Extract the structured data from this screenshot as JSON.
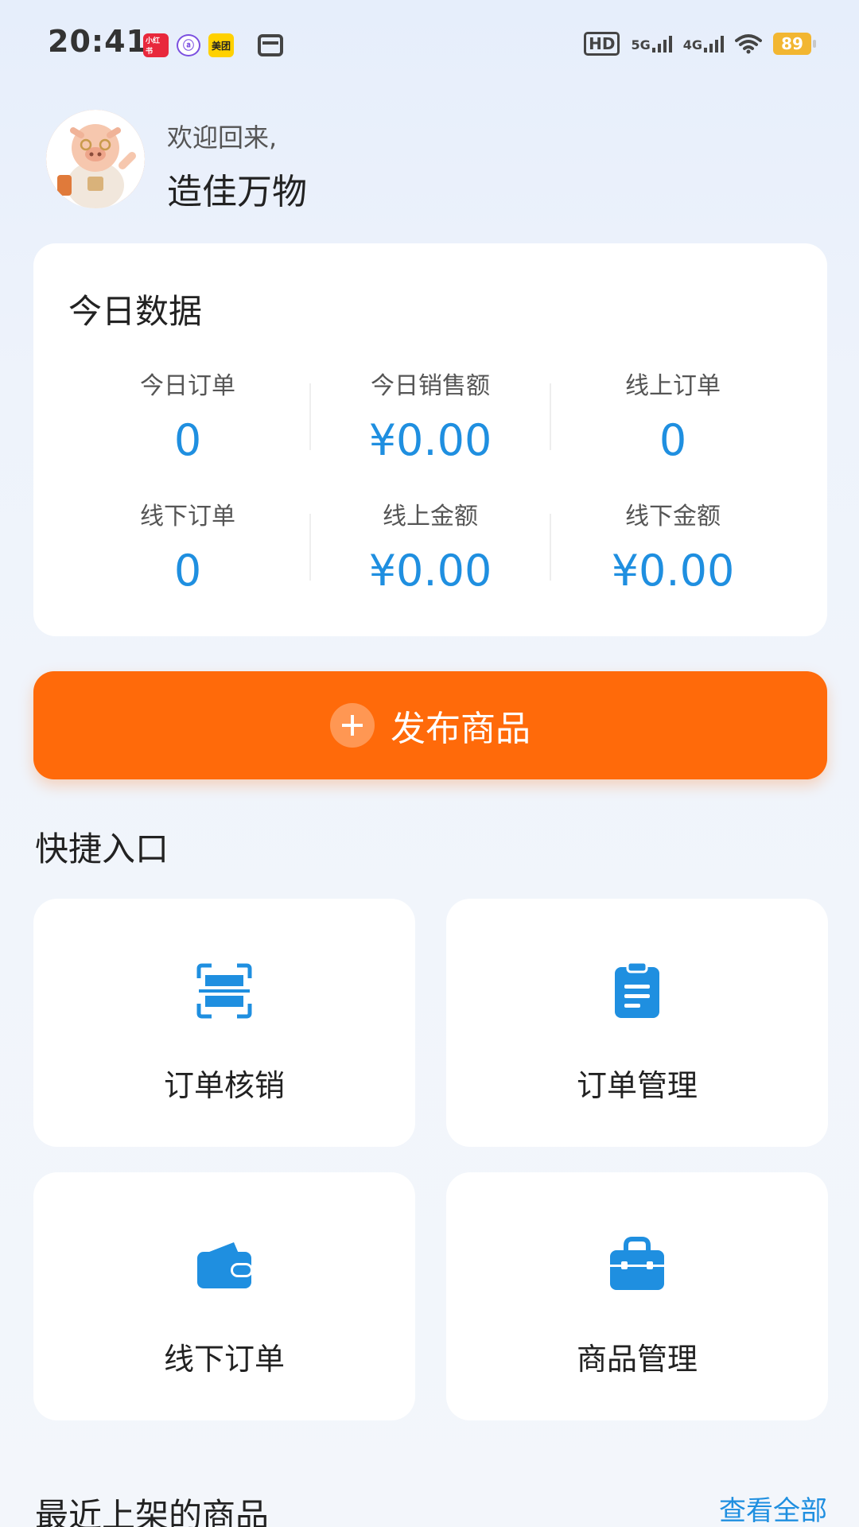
{
  "status_bar": {
    "time": "20:41",
    "app_icons": [
      "小红书",
      "ⓐ",
      "美团"
    ],
    "hd": "HD",
    "net1": "5G",
    "net2": "4G",
    "battery": "89"
  },
  "header": {
    "welcome": "欢迎回来,",
    "shop_name": "造佳万物"
  },
  "today": {
    "title": "今日数据",
    "stats": [
      {
        "label": "今日订单",
        "value": "0"
      },
      {
        "label": "今日销售额",
        "value": "¥0.00"
      },
      {
        "label": "线上订单",
        "value": "0"
      },
      {
        "label": "线下订单",
        "value": "0"
      },
      {
        "label": "线上金额",
        "value": "¥0.00"
      },
      {
        "label": "线下金额",
        "value": "¥0.00"
      }
    ]
  },
  "publish": {
    "label": "发布商品"
  },
  "quick": {
    "title": "快捷入口",
    "items": [
      {
        "label": "订单核销",
        "icon": "scan-icon"
      },
      {
        "label": "订单管理",
        "icon": "clipboard-icon"
      },
      {
        "label": "线下订单",
        "icon": "wallet-icon"
      },
      {
        "label": "商品管理",
        "icon": "bag-icon"
      }
    ]
  },
  "recent": {
    "title": "最近上架的商品",
    "view_all": "查看全部"
  },
  "colors": {
    "accent_blue": "#1f8fe0",
    "publish_orange": "#ff6a0a",
    "battery": "#f2b631"
  }
}
